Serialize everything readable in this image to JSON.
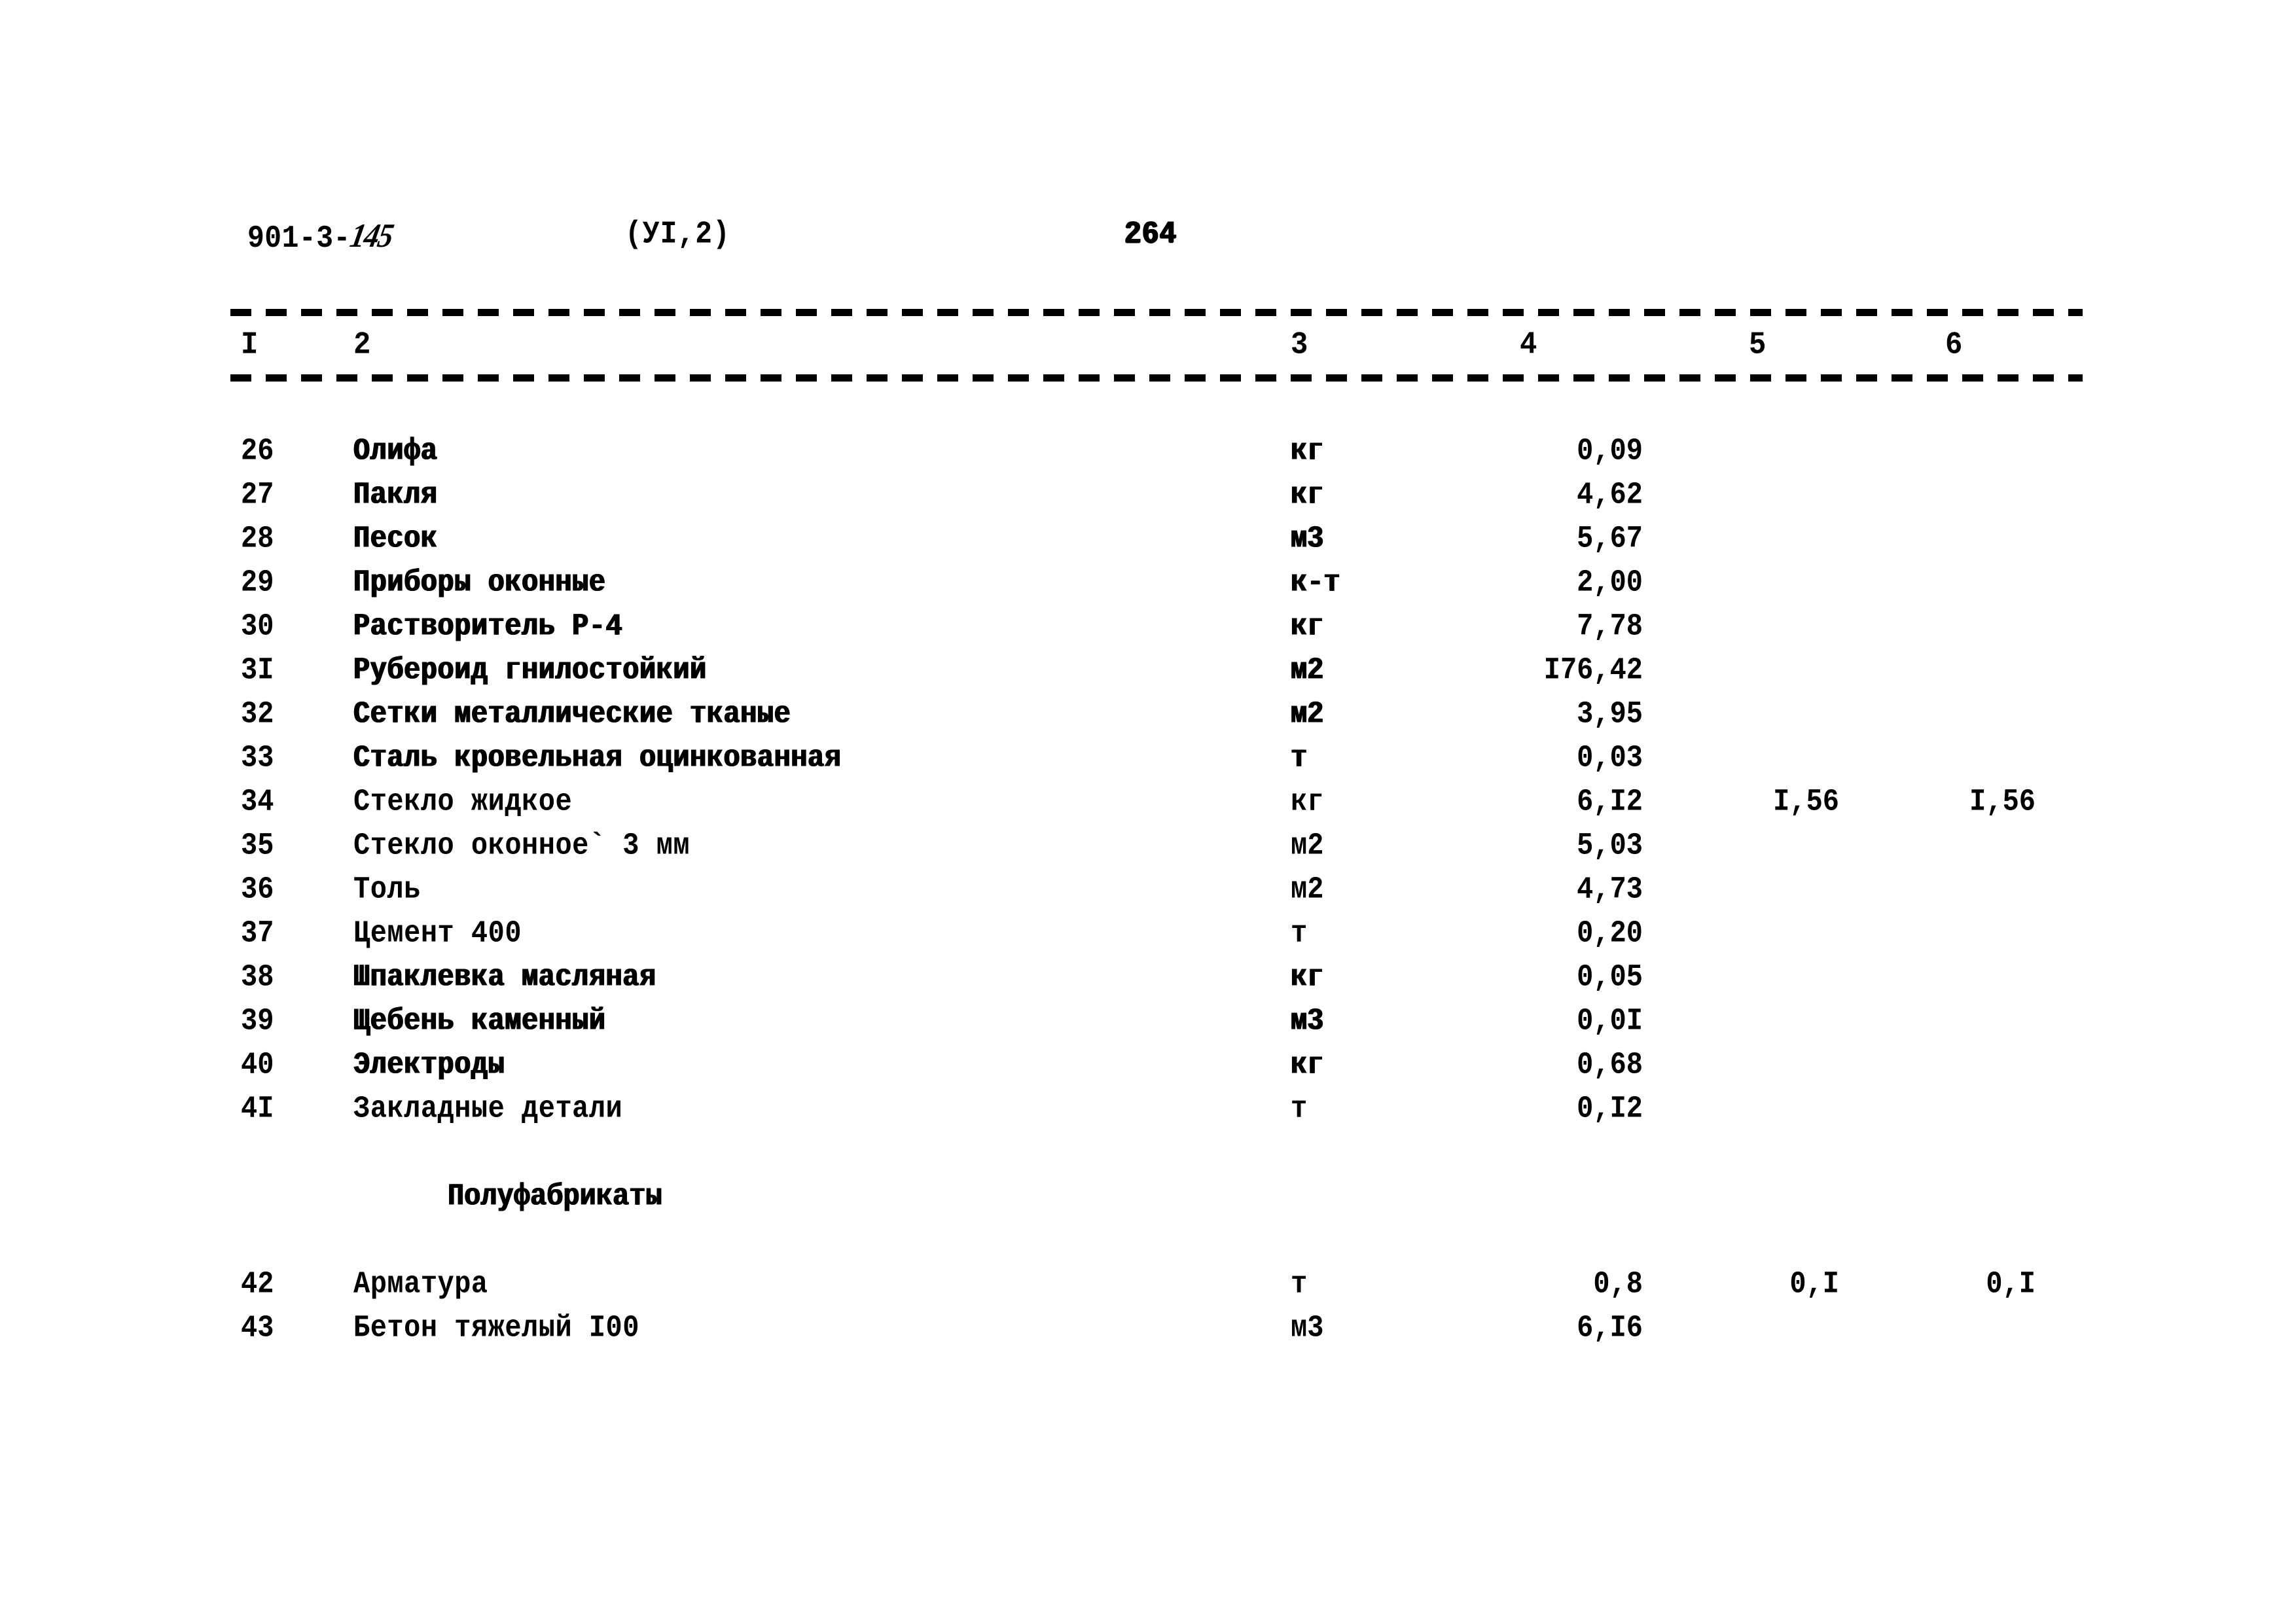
{
  "header": {
    "doc_code_prefix": "901-3-",
    "doc_code_handwritten": "145",
    "section_ref": "(УI,2)",
    "page_number": "264"
  },
  "table": {
    "column_headers": [
      "I",
      "2",
      "3",
      "4",
      "5",
      "6"
    ],
    "rows": [
      {
        "no": "26",
        "name": "Олифа",
        "unit": "кг",
        "v4": "0,09",
        "v5": "",
        "v6": ""
      },
      {
        "no": "27",
        "name": "Пакля",
        "unit": "кг",
        "v4": "4,62",
        "v5": "",
        "v6": ""
      },
      {
        "no": "28",
        "name": "Песок",
        "unit": "м3",
        "v4": "5,67",
        "v5": "",
        "v6": ""
      },
      {
        "no": "29",
        "name": "Приборы оконные",
        "unit": "к-т",
        "v4": "2,00",
        "v5": "",
        "v6": ""
      },
      {
        "no": "30",
        "name": "Растворитель Р-4",
        "unit": "кг",
        "v4": "7,78",
        "v5": "",
        "v6": ""
      },
      {
        "no": "3I",
        "name": "Рубероид гнилостойкий",
        "unit": "м2",
        "v4": "I76,42",
        "v5": "",
        "v6": ""
      },
      {
        "no": "32",
        "name": "Сетки металлические тканые",
        "unit": "м2",
        "v4": "3,95",
        "v5": "",
        "v6": ""
      },
      {
        "no": "33",
        "name": "Сталь кровельная оцинкованная",
        "unit": "т",
        "v4": "0,03",
        "v5": "",
        "v6": ""
      },
      {
        "no": "34",
        "name": "Стекло жидкое",
        "unit": "кг",
        "v4": "6,I2",
        "v5": "I,56",
        "v6": "I,56"
      },
      {
        "no": "35",
        "name": "Стекло оконное` 3 мм",
        "unit": "м2",
        "v4": "5,03",
        "v5": "",
        "v6": ""
      },
      {
        "no": "36",
        "name": "Толь",
        "unit": "м2",
        "v4": "4,73",
        "v5": "",
        "v6": ""
      },
      {
        "no": "37",
        "name": "Цемент 400",
        "unit": "т",
        "v4": "0,20",
        "v5": "",
        "v6": ""
      },
      {
        "no": "38",
        "name": "Шпаклевка масляная",
        "unit": "кг",
        "v4": "0,05",
        "v5": "",
        "v6": ""
      },
      {
        "no": "39",
        "name": "Щебень каменный",
        "unit": "м3",
        "v4": "0,0I",
        "v5": "",
        "v6": ""
      },
      {
        "no": "40",
        "name": "Электроды",
        "unit": "кг",
        "v4": "0,68",
        "v5": "",
        "v6": ""
      },
      {
        "no": "4I",
        "name": "Закладные детали",
        "unit": "т",
        "v4": "0,I2",
        "v5": "",
        "v6": ""
      }
    ],
    "group_title": "Полуфабрикаты",
    "group_rows": [
      {
        "no": "42",
        "name": "Арматура",
        "unit": "т",
        "v4": "0,8",
        "v5": "0,I",
        "v6": "0,I"
      },
      {
        "no": "43",
        "name": "Бетон тяжелый I00",
        "unit": "м3",
        "v4": "6,I6",
        "v5": "",
        "v6": ""
      }
    ]
  }
}
